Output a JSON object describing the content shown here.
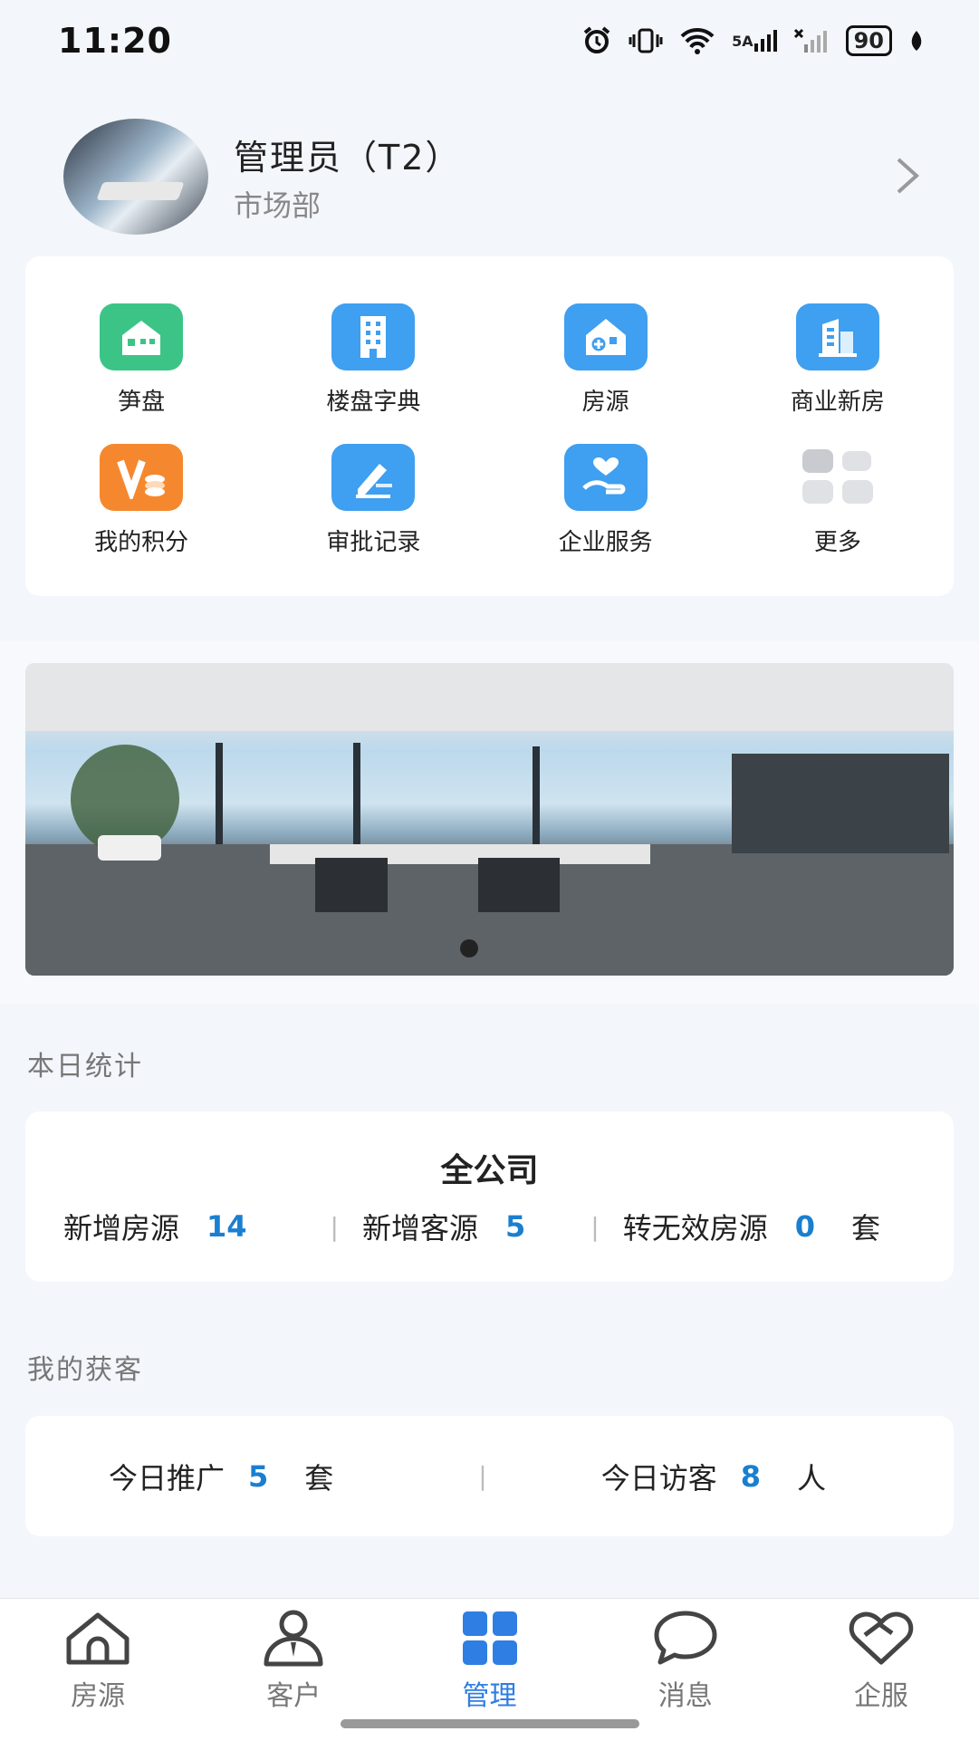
{
  "status_bar": {
    "time": "11:20",
    "network_label": "5A",
    "battery": "90"
  },
  "profile": {
    "name": "管理员（T2）",
    "department": "市场部"
  },
  "menu": [
    {
      "label": "笋盘",
      "icon": "house-icon",
      "color": "#3cc487"
    },
    {
      "label": "楼盘字典",
      "icon": "building-icon",
      "color": "#3f9ff0"
    },
    {
      "label": "房源",
      "icon": "house-add-icon",
      "color": "#3f9ff0"
    },
    {
      "label": "商业新房",
      "icon": "commercial-building-icon",
      "color": "#3f9ff0"
    },
    {
      "label": "我的积分",
      "icon": "points-icon",
      "color": "#f5882e"
    },
    {
      "label": "审批记录",
      "icon": "edit-record-icon",
      "color": "#3f9ff0"
    },
    {
      "label": "企业服务",
      "icon": "hand-heart-icon",
      "color": "#3f9ff0"
    },
    {
      "label": "更多",
      "icon": "more-grid-icon",
      "color": "#d7d9de"
    }
  ],
  "daily_stats": {
    "section_title": "本日统计",
    "scope": "全公司",
    "items": [
      {
        "label": "新增房源",
        "value": "14"
      },
      {
        "label": "新增客源",
        "value": "5"
      },
      {
        "label": "转无效房源",
        "value": "0",
        "unit": "套"
      }
    ]
  },
  "my_leads": {
    "section_title": "我的获客",
    "items": [
      {
        "label": "今日推广",
        "value": "5",
        "unit": "套"
      },
      {
        "label": "今日访客",
        "value": "8",
        "unit": "人"
      }
    ]
  },
  "tabs": [
    {
      "label": "房源",
      "icon": "home-icon",
      "active": false
    },
    {
      "label": "客户",
      "icon": "person-icon",
      "active": false
    },
    {
      "label": "管理",
      "icon": "grid-icon",
      "active": true
    },
    {
      "label": "消息",
      "icon": "chat-bubble-icon",
      "active": false
    },
    {
      "label": "企服",
      "icon": "handshake-heart-icon",
      "active": false
    }
  ],
  "colors": {
    "accent": "#2f7ee3",
    "number": "#1b7fd0",
    "background": "#f3f6fb"
  }
}
